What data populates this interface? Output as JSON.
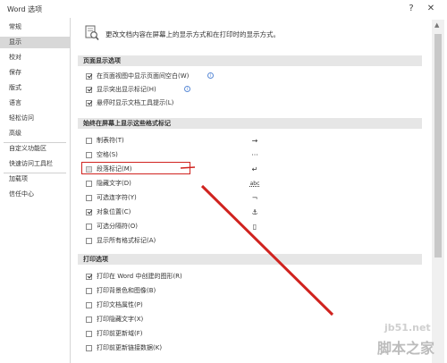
{
  "window": {
    "title": "Word 选项",
    "help": "?",
    "close": "✕"
  },
  "sidebar": {
    "items": [
      {
        "label": "常规"
      },
      {
        "label": "显示"
      },
      {
        "label": "校对"
      },
      {
        "label": "保存"
      },
      {
        "label": "版式"
      },
      {
        "label": "语言"
      },
      {
        "label": "轻松访问"
      },
      {
        "label": "高级"
      },
      {
        "label": "自定义功能区"
      },
      {
        "label": "快速访问工具栏"
      },
      {
        "label": "加载项"
      },
      {
        "label": "信任中心"
      }
    ],
    "selected_index": 1
  },
  "header": {
    "text": "更改文档内容在屏幕上的显示方式和在打印时的显示方式。"
  },
  "sections": {
    "page_display": {
      "title": "页面显示选项",
      "options": [
        {
          "label": "在页面视图中显示页面间空白(W)",
          "checked": true
        },
        {
          "label": "显示突出显示标记(H)",
          "checked": true
        },
        {
          "label": "悬停时显示文档工具提示(L)",
          "checked": true
        }
      ]
    },
    "format_marks": {
      "title": "始终在屏幕上显示这些格式标记",
      "options": [
        {
          "label": "制表符(T)",
          "checked": false,
          "mark": "→"
        },
        {
          "label": "空格(S)",
          "checked": false,
          "mark": "···"
        },
        {
          "label": "段落标记(M)",
          "checked": false,
          "greyed": true,
          "mark": "↵"
        },
        {
          "label": "隐藏文字(D)",
          "checked": false,
          "mark": "abc"
        },
        {
          "label": "可选连字符(Y)",
          "checked": false,
          "mark": "¬"
        },
        {
          "label": "对象位置(C)",
          "checked": true,
          "mark": "⚓"
        },
        {
          "label": "可选分隔符(O)",
          "checked": false,
          "mark": "▯"
        },
        {
          "label": "显示所有格式标记(A)",
          "checked": false,
          "mark": ""
        }
      ]
    },
    "print": {
      "title": "打印选项",
      "options": [
        {
          "label": "打印在 Word 中创建的图形(R)",
          "checked": true
        },
        {
          "label": "打印背景色和图像(B)",
          "checked": false
        },
        {
          "label": "打印文档属性(P)",
          "checked": false
        },
        {
          "label": "打印隐藏文字(X)",
          "checked": false
        },
        {
          "label": "打印前更新域(F)",
          "checked": false
        },
        {
          "label": "打印前更新链接数据(K)",
          "checked": false
        }
      ]
    }
  },
  "icons": {
    "info": "info-icon",
    "header": "display-settings-icon",
    "scroll_up": "scroll-up-arrow-icon"
  },
  "colors": {
    "annotation_red": "#d0231f",
    "selected_bg": "#d8d8d8",
    "section_bg": "#e6e6e6"
  },
  "watermark": {
    "url": "jb51.net",
    "name": "脚本之家"
  }
}
